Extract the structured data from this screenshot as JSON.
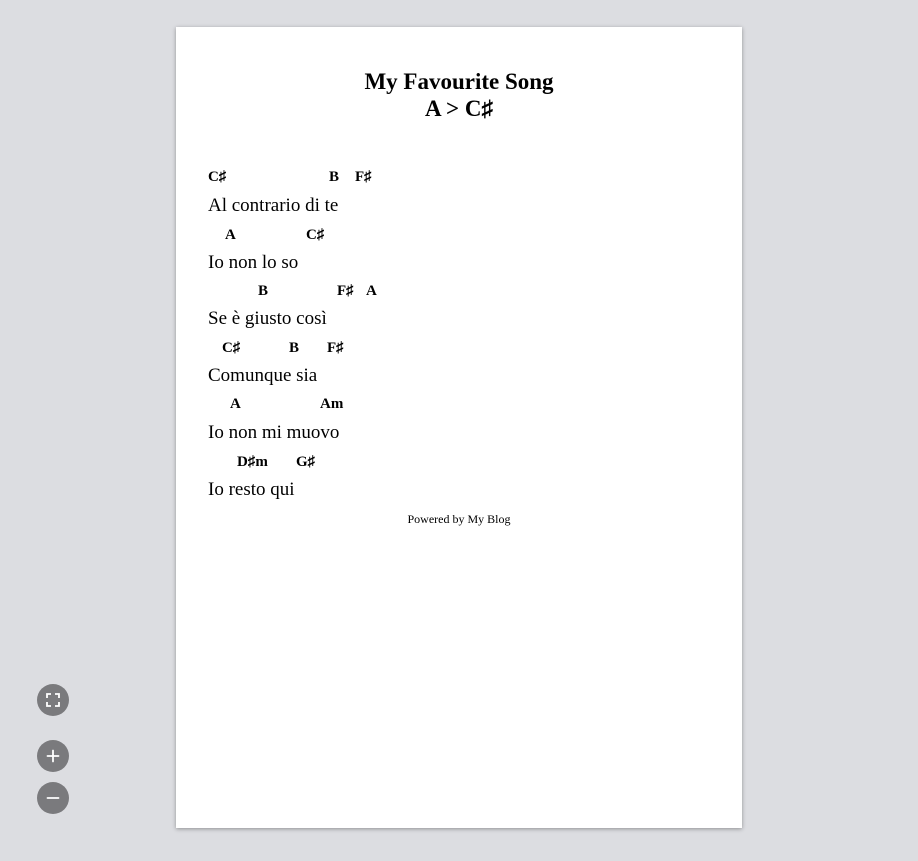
{
  "song": {
    "title": "My Favourite Song",
    "transposition": "A > C♯"
  },
  "lines": [
    {
      "chords": [
        "C♯",
        "B",
        "F♯"
      ],
      "lyric": "Al contrario di te"
    },
    {
      "chords": [
        "A",
        "C♯"
      ],
      "lyric": "Io non lo so"
    },
    {
      "chords": [
        "B",
        "F♯",
        "A"
      ],
      "lyric": "Se è giusto così"
    },
    {
      "chords": [
        "C♯",
        "B",
        "F♯"
      ],
      "lyric": "Comunque sia"
    },
    {
      "chords": [
        "A",
        "Am"
      ],
      "lyric": "Io non mi muovo"
    },
    {
      "chords": [
        "D♯m",
        "G♯"
      ],
      "lyric": "Io resto qui"
    }
  ],
  "footer": "Powered by My Blog",
  "controls": {
    "fullscreen_icon": "fullscreen-icon",
    "zoom_in_icon": "plus-icon",
    "zoom_out_icon": "minus-icon"
  }
}
